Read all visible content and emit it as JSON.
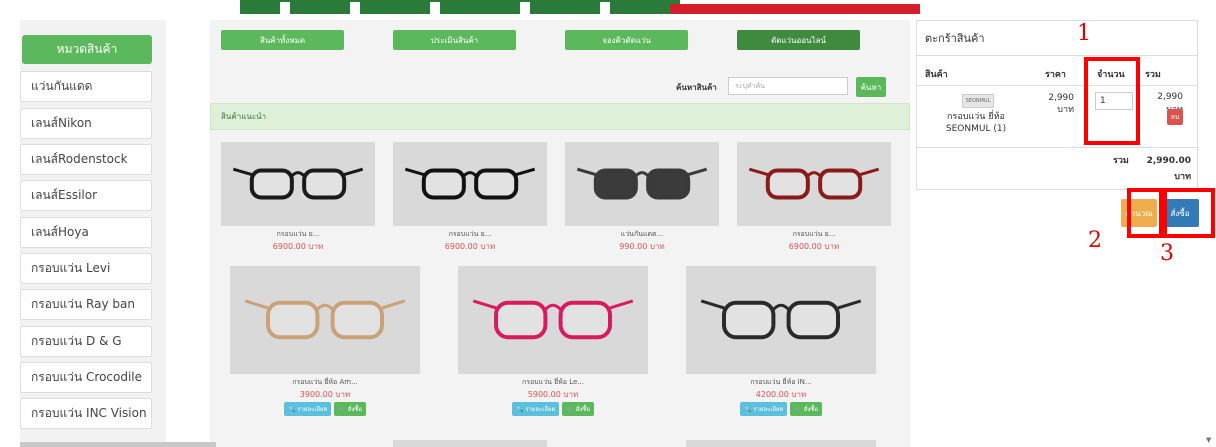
{
  "categories": {
    "heading": "หมวดสินค้า",
    "items": [
      {
        "label": "แว่นกันแดด"
      },
      {
        "label": "เลนส์Nikon"
      },
      {
        "label": "เลนส์Rodenstock"
      },
      {
        "label": "เลนส์Essilor"
      },
      {
        "label": "เลนส์Hoya"
      },
      {
        "label": "กรอบแว่น Levi"
      },
      {
        "label": "กรอบแว่น Ray ban"
      },
      {
        "label": "กรอบแว่น D & G"
      },
      {
        "label": "กรอบแว่น Crocodile"
      },
      {
        "label": "กรอบแว่น INC Vision"
      }
    ]
  },
  "nav": {
    "all_products": "สินค้าทั้งหมด",
    "evaluate": "ประเมินสินค้า",
    "booking": "จองคิวตัดแว่น",
    "online": "ตัดแว่นออนไลน์"
  },
  "search": {
    "label": "ค้นหาสินค้า",
    "placeholder": "ระบุคำค้น",
    "button": "ค้นหา"
  },
  "recommended_label": "สินค้าแนะนำ",
  "products_row1": [
    {
      "name": "กรอบแว่น ย...",
      "price": "6900.00 บาท",
      "frame_color": "#1a1a1a",
      "lens": "clear"
    },
    {
      "name": "กรอบแว่น ย...",
      "price": "6900.00 บาท",
      "frame_color": "#111111",
      "lens": "clear"
    },
    {
      "name": "แว่นกันแดด...",
      "price": "990.00 บาท",
      "frame_color": "#3a3a3a",
      "lens": "dark"
    },
    {
      "name": "กรอบแว่น ย...",
      "price": "6900.00 บาท",
      "frame_color": "#8b1a1a",
      "lens": "clear"
    }
  ],
  "products_row2": [
    {
      "name": "กรอบแว่น ยี่ห้อ Am...",
      "price": "3900.00 บาท",
      "frame_color": "#c9a27a",
      "lens": "clear"
    },
    {
      "name": "กรอบแว่น ยี่ห้อ Le...",
      "price": "5900.00 บาท",
      "frame_color": "#d81b60",
      "lens": "clear"
    },
    {
      "name": "กรอบแว่น ยี่ห้อ IN...",
      "price": "4200.00 บาท",
      "frame_color": "#2a2a2a",
      "lens": "clear"
    }
  ],
  "card_buttons": {
    "details": "🔍 รายละเอียด",
    "order": "🛒 สั่งซื้อ"
  },
  "cart": {
    "title": "ตะกร้าสินค้า",
    "col_product": "สินค้า",
    "col_price": "ราคา",
    "col_qty": "จำนวน",
    "col_total": "รวม",
    "item_name": "กรอบแว่น ยี่ห้อ SEONMUL (1)",
    "item_price": "2,990 บาท",
    "item_qty": "1",
    "item_total": "2,990 บาท",
    "delete": "ลบ",
    "sum_label": "รวม",
    "sum_value": "2,990.00 บาท",
    "calc_button": "คำนวณ",
    "order_button": "สั่งซื้อ"
  },
  "annotations": {
    "m1": "1",
    "m2": "2",
    "m3": "3"
  }
}
